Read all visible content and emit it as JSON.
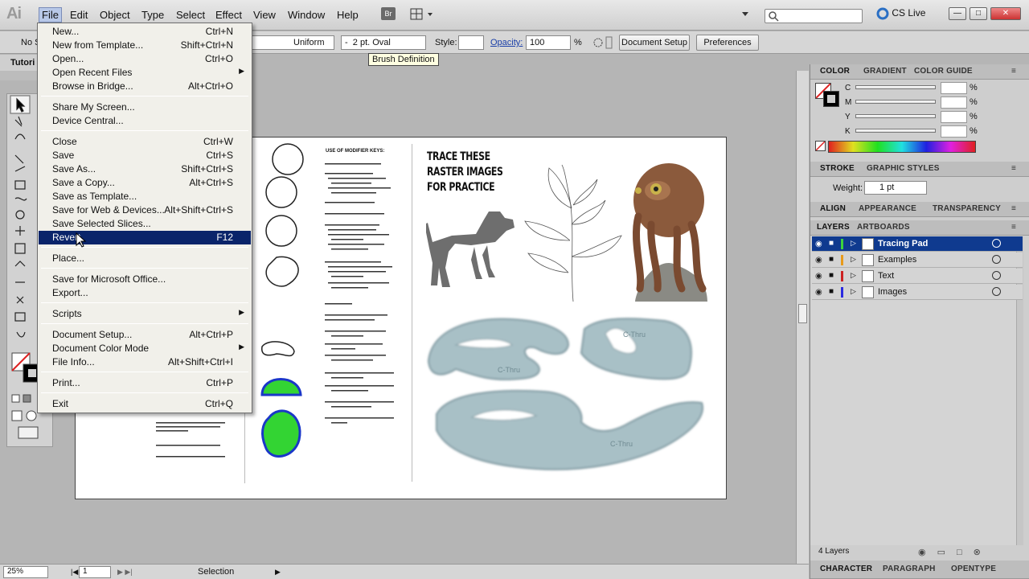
{
  "menubar": {
    "logo": "Ai",
    "items": [
      "File",
      "Edit",
      "Object",
      "Type",
      "Select",
      "Effect",
      "View",
      "Window",
      "Help"
    ],
    "bridge_label": "Br",
    "cs_live": "CS Live"
  },
  "control_bar": {
    "selection_label": "No S",
    "stroke_style": "Uniform",
    "brush": "2 pt. Oval",
    "style_label": "Style:",
    "opacity_label": "Opacity:",
    "opacity_value": "100",
    "opacity_unit": "%",
    "document_setup": "Document Setup",
    "preferences": "Preferences",
    "tooltip": "Brush Definition"
  },
  "doc_tab": "Tutori",
  "file_menu": [
    {
      "label": "New...",
      "shortcut": "Ctrl+N"
    },
    {
      "label": "New from Template...",
      "shortcut": "Shift+Ctrl+N"
    },
    {
      "label": "Open...",
      "shortcut": "Ctrl+O"
    },
    {
      "label": "Open Recent Files",
      "shortcut": "",
      "submenu": true
    },
    {
      "label": "Browse in Bridge...",
      "shortcut": "Alt+Ctrl+O"
    },
    {
      "label": "Share My Screen...",
      "shortcut": ""
    },
    {
      "label": "Device Central...",
      "shortcut": ""
    },
    {
      "label": "Close",
      "shortcut": "Ctrl+W"
    },
    {
      "label": "Save",
      "shortcut": "Ctrl+S"
    },
    {
      "label": "Save As...",
      "shortcut": "Shift+Ctrl+S"
    },
    {
      "label": "Save a Copy...",
      "shortcut": "Alt+Ctrl+S"
    },
    {
      "label": "Save as Template...",
      "shortcut": ""
    },
    {
      "label": "Save for Web & Devices...",
      "shortcut": "Alt+Shift+Ctrl+S"
    },
    {
      "label": "Save Selected Slices...",
      "shortcut": ""
    },
    {
      "label": "Revert",
      "shortcut": "F12",
      "highlighted": true
    },
    {
      "label": "Place...",
      "shortcut": ""
    },
    {
      "label": "Save for Microsoft Office...",
      "shortcut": ""
    },
    {
      "label": "Export...",
      "shortcut": ""
    },
    {
      "label": "Scripts",
      "shortcut": "",
      "submenu": true
    },
    {
      "label": "Document Setup...",
      "shortcut": "Alt+Ctrl+P"
    },
    {
      "label": "Document Color Mode",
      "shortcut": "",
      "submenu": true
    },
    {
      "label": "File Info...",
      "shortcut": "Alt+Shift+Ctrl+I"
    },
    {
      "label": "Print...",
      "shortcut": "Ctrl+P"
    },
    {
      "label": "Exit",
      "shortcut": "Ctrl+Q"
    }
  ],
  "artboard": {
    "heading": "TRACE THESE\nRASTER IMAGES\nFOR PRACTICE",
    "tips_title": "USE OF MODIFIER KEYS:",
    "curve_label": "C-Thru"
  },
  "panels": {
    "color_tabs": [
      "COLOR",
      "GRADIENT",
      "COLOR GUIDE"
    ],
    "cmyk": [
      "C",
      "M",
      "Y",
      "K"
    ],
    "pct": "%",
    "stroke_tabs": [
      "STROKE",
      "GRAPHIC STYLES"
    ],
    "weight_label": "Weight:",
    "weight_value": "1 pt",
    "align_tabs": [
      "ALIGN",
      "APPEARANCE",
      "TRANSPARENCY"
    ],
    "layers_tabs": [
      "LAYERS",
      "ARTBOARDS"
    ],
    "layers": [
      {
        "name": "Tracing Pad",
        "color": "#3dd43d",
        "selected": true
      },
      {
        "name": "Examples",
        "color": "#e89a1a",
        "selected": false
      },
      {
        "name": "Text",
        "color": "#cc2222",
        "selected": false
      },
      {
        "name": "Images",
        "color": "#2a2ae0",
        "selected": false
      }
    ],
    "layer_count": "4 Layers",
    "bottom_tabs": [
      "CHARACTER",
      "PARAGRAPH",
      "OPENTYPE"
    ]
  },
  "status": {
    "zoom": "25%",
    "page": "1",
    "tool": "Selection"
  }
}
